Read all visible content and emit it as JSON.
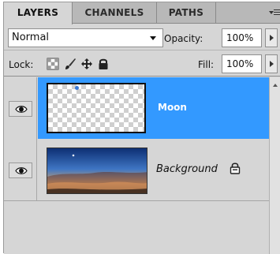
{
  "tabs": [
    {
      "label": "LAYERS",
      "active": true
    },
    {
      "label": "CHANNELS",
      "active": false
    },
    {
      "label": "PATHS",
      "active": false
    }
  ],
  "blend_mode": {
    "value": "Normal"
  },
  "opacity": {
    "label": "Opacity:",
    "value": "100%"
  },
  "lock": {
    "label": "Lock:",
    "icons": [
      "lock-transparent-pixels-icon",
      "lock-image-pixels-icon",
      "lock-position-icon",
      "lock-all-icon"
    ]
  },
  "fill": {
    "label": "Fill:",
    "value": "100%"
  },
  "layers": [
    {
      "name": "Moon",
      "visible": true,
      "selected": true,
      "locked": false
    },
    {
      "name": "Background",
      "visible": true,
      "selected": false,
      "locked": true
    }
  ],
  "colors": {
    "selection": "#3399ff",
    "panel": "#d6d6d6"
  }
}
